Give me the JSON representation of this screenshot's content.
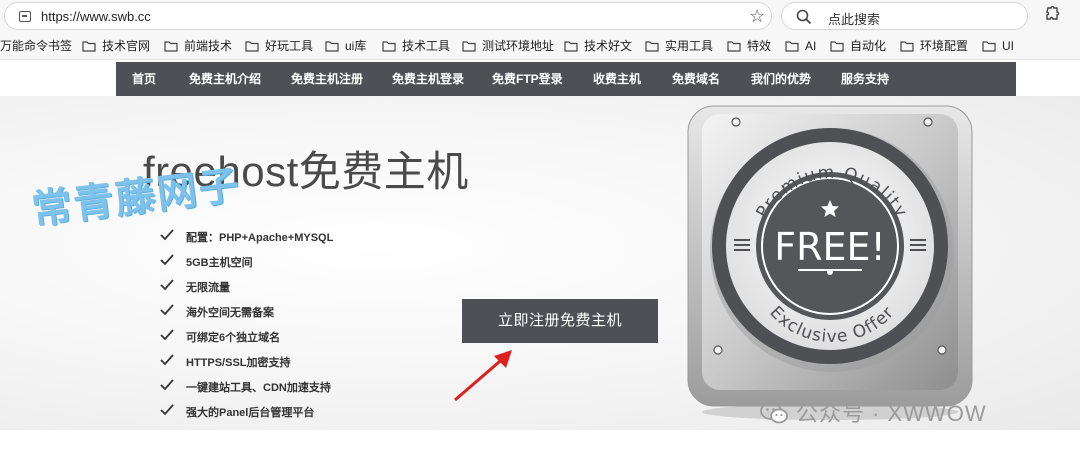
{
  "browser": {
    "url": "https://www.swb.cc",
    "search_placeholder": "点此搜索"
  },
  "bookmarks": [
    {
      "label": "万能命令书签",
      "has_folder": false
    },
    {
      "label": "技术官网",
      "has_folder": true
    },
    {
      "label": "前端技术",
      "has_folder": true
    },
    {
      "label": "好玩工具",
      "has_folder": true
    },
    {
      "label": "ui库",
      "has_folder": true
    },
    {
      "label": "技术工具",
      "has_folder": true
    },
    {
      "label": "测试环境地址",
      "has_folder": true
    },
    {
      "label": "技术好文",
      "has_folder": true
    },
    {
      "label": "实用工具",
      "has_folder": true
    },
    {
      "label": "特效",
      "has_folder": true
    },
    {
      "label": "AI",
      "has_folder": true
    },
    {
      "label": "自动化",
      "has_folder": true
    },
    {
      "label": "环境配置",
      "has_folder": true
    },
    {
      "label": "UI",
      "has_folder": true
    }
  ],
  "nav": {
    "items": [
      "首页",
      "免费主机介绍",
      "免费主机注册",
      "免费主机登录",
      "免费FTP登录",
      "收费主机",
      "免费域名",
      "我们的优势",
      "服务支持"
    ]
  },
  "hero": {
    "title": "freehost免费主机",
    "watermark": "常青藤网子",
    "features": [
      "配置：PHP+Apache+MYSQL",
      "5GB主机空间",
      "无限流量",
      "海外空间无需备案",
      "可绑定6个独立域名",
      "HTTPS/SSL加密支持",
      "一键建站工具、CDN加速支持",
      "强大的Panel后台管理平台"
    ],
    "cta_label": "立即注册免费主机"
  },
  "badge": {
    "top_text": "Premium Quality",
    "center_text": "FREE!",
    "bottom_text": "Exclusive Offer"
  },
  "footer_watermark": {
    "text": "公众号 · XWWOW"
  },
  "colors": {
    "nav_bg": "#4e5055",
    "cta_bg": "#4e5055",
    "watermark": "#7ec1ea",
    "arrow": "#e02020"
  }
}
